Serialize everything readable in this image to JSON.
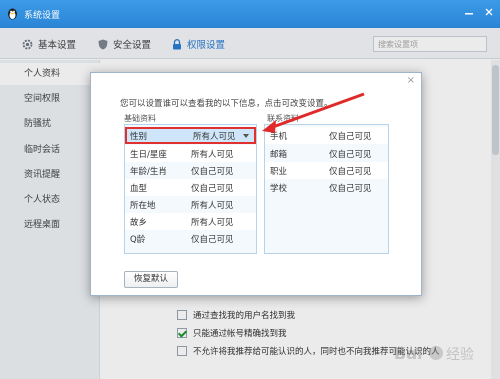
{
  "window": {
    "title": "系统设置"
  },
  "tabs": [
    {
      "label": "基本设置",
      "icon": "gear-icon"
    },
    {
      "label": "安全设置",
      "icon": "shield-icon"
    },
    {
      "label": "权限设置",
      "icon": "lock-icon"
    }
  ],
  "search": {
    "placeholder": "搜索设置项"
  },
  "sidebar": {
    "items": [
      {
        "label": "个人资料"
      },
      {
        "label": "空间权限"
      },
      {
        "label": "防骚扰"
      },
      {
        "label": "临时会话"
      },
      {
        "label": "资讯提醒"
      },
      {
        "label": "个人状态"
      },
      {
        "label": "远程桌面"
      }
    ]
  },
  "main": {
    "options": [
      {
        "label": "通过查找我的用户名找到我",
        "checked": false
      },
      {
        "label": "只能通过帐号精确找到我",
        "checked": true
      },
      {
        "label": "不允许将我推荐给可能认识的人，同时也不向我推荐可能认识的人",
        "checked": false
      }
    ]
  },
  "dialog": {
    "close_label": "×",
    "description": "您可以设置谁可以查看我的以下信息，点击可改变设置。",
    "left_group_label": "基础资料",
    "right_group_label": "联系资料",
    "basic_rows": [
      {
        "name": "性别",
        "value": "所有人可见"
      },
      {
        "name": "生日/星座",
        "value": "所有人可见"
      },
      {
        "name": "年龄/生肖",
        "value": "仅自己可见"
      },
      {
        "name": "血型",
        "value": "仅自己可见"
      },
      {
        "name": "所在地",
        "value": "所有人可见"
      },
      {
        "name": "故乡",
        "value": "所有人可见"
      },
      {
        "name": "Q龄",
        "value": "仅自己可见"
      }
    ],
    "contact_rows": [
      {
        "name": "手机",
        "value": "仅自己可见"
      },
      {
        "name": "邮箱",
        "value": "仅自己可见"
      },
      {
        "name": "职业",
        "value": "仅自己可见"
      },
      {
        "name": "学校",
        "value": "仅自己可见"
      }
    ],
    "restore_label": "恢复默认"
  },
  "colors": {
    "accent": "#2a7cd4",
    "titlebar": "#2a84d6",
    "highlight": "#e03030"
  }
}
